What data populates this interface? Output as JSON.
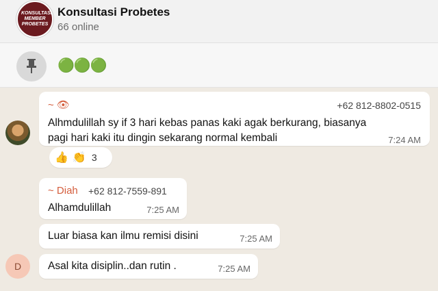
{
  "header": {
    "avatar_text": "KONSULTASI MEMBER PROBETES",
    "title": "Konsultasi Probetes",
    "subtitle": "66 online"
  },
  "pinned": {
    "text": "🟢🟢🟢"
  },
  "messages": [
    {
      "sender_name": "~ 👁",
      "sender_phone": "+62 812-8802-0515",
      "text_line1": "Alhmdulillah sy if 3 hari kebas panas kaki agak berkurang, biasanya",
      "text_line2": "pagi hari kaki itu dingin sekarang normal kembali",
      "time": "7:24 AM",
      "reactions": {
        "emoji1": "👍",
        "emoji2": "👏",
        "count": "3"
      }
    },
    {
      "sender_name": "~ Diah",
      "sender_phone": "+62 812-7559-891",
      "text": "Alhamdulillah",
      "time": "7:25 AM"
    },
    {
      "text": "Luar biasa kan ilmu remisi disini",
      "time": "7:25 AM"
    },
    {
      "text": "Asal kita disiplin..dan rutin .",
      "time": "7:25 AM",
      "avatar_letter": "D"
    }
  ],
  "colors": {
    "sender_name": "#d45d3c",
    "background": "#efeae2"
  },
  "icons": {
    "pin": "pin-icon"
  }
}
